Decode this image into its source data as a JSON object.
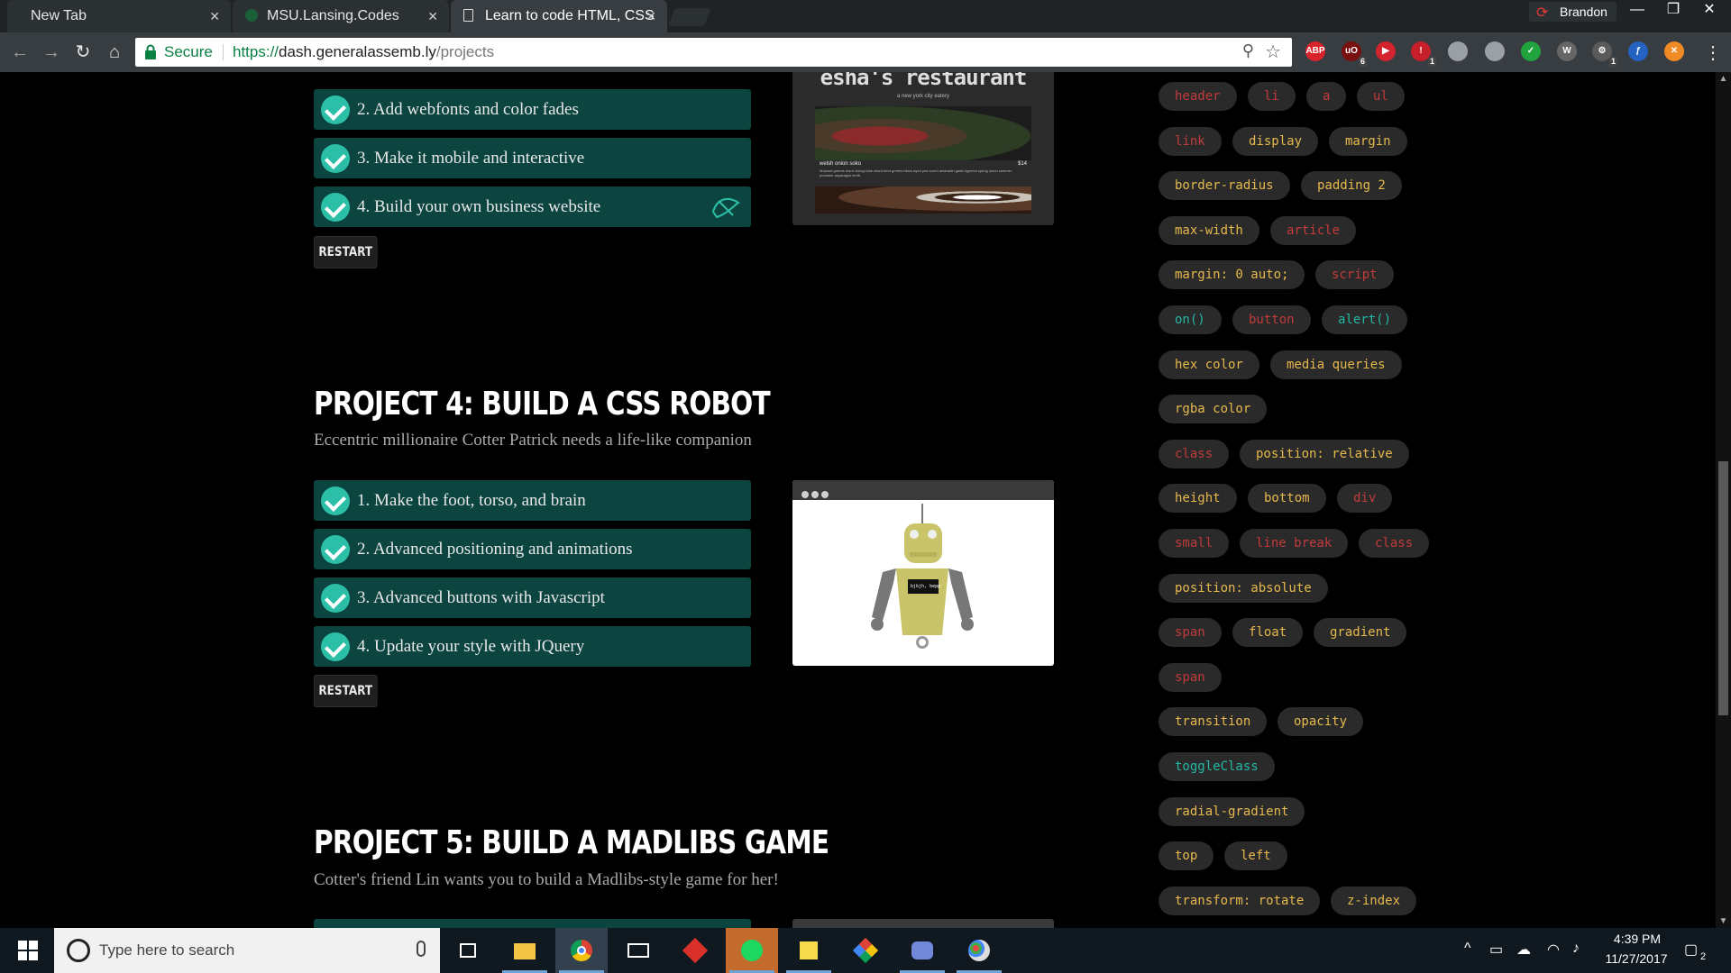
{
  "browser": {
    "tabs": [
      {
        "label": "New Tab",
        "active": false
      },
      {
        "label": "MSU.Lansing.Codes",
        "active": false
      },
      {
        "label": "Learn to code HTML, CSS",
        "active": true
      }
    ],
    "profile_name": "Brandon",
    "secure_label": "Secure",
    "url_scheme": "https://",
    "url_host": "dash.generalassemb.ly",
    "url_path": "/projects",
    "extensions": [
      {
        "name": "adblock-plus-icon",
        "text": "ABP",
        "color": "#d9232a",
        "badge": ""
      },
      {
        "name": "ublock-icon",
        "text": "uO",
        "color": "#7a0f0f",
        "badge": "6"
      },
      {
        "name": "pocket-icon",
        "text": "▶",
        "color": "#d3232f",
        "badge": ""
      },
      {
        "name": "lastpass-icon",
        "text": "!",
        "color": "#c8202b",
        "badge": "1"
      },
      {
        "name": "extension-gray-icon",
        "text": "",
        "color": "#9aa0a4",
        "badge": ""
      },
      {
        "name": "extension-gray2-icon",
        "text": "",
        "color": "#9aa0a4",
        "badge": ""
      },
      {
        "name": "grammarly-check-icon",
        "text": "✓",
        "color": "#21a33e",
        "badge": ""
      },
      {
        "name": "wikipedia-icon",
        "text": "W",
        "color": "#666",
        "badge": ""
      },
      {
        "name": "ext-red-badge-icon",
        "text": "⚙",
        "color": "#5a5a5a",
        "badge": "1"
      },
      {
        "name": "ext-blue-icon",
        "text": "ƒ",
        "color": "#2463c2",
        "badge": ""
      },
      {
        "name": "ext-orange-icon",
        "text": "✕",
        "color": "#f08a24",
        "badge": ""
      }
    ]
  },
  "project3": {
    "steps": [
      "2. Add webfonts and color fades",
      "3. Make it mobile and interactive",
      "4. Build your own business website"
    ],
    "restart_label": "RESTART",
    "thumb_title": "esha's restaurant",
    "thumb_tagline": "a new york city eatery",
    "thumb_dish": "welsh onion soko",
    "thumb_price": "$14",
    "thumb_desc": "Mustard greens leone bologi kale chard beet greens black-eyed pea sorrel amaranth garlic tigernut spring onion summer purslane asparagus lentil."
  },
  "project4": {
    "title": "PROJECT 4: BUILD A CSS ROBOT",
    "subtitle": "Eccentric millionaire Cotter Patrick needs a life-like companion",
    "steps": [
      "1. Make the foot, torso, and brain",
      "2. Advanced positioning and animations",
      "3. Advanced buttons with Javascript",
      "4. Update your style with JQuery"
    ],
    "restart_label": "RESTART",
    "robot_screen_text": "bjkjh, bepp"
  },
  "project5": {
    "title": "PROJECT 5: BUILD A MADLIBS GAME",
    "subtitle": "Cotter's friend Lin wants you to build a Madlibs-style game for her!"
  },
  "concepts": {
    "rows": [
      [
        {
          "t": "header",
          "c": "red"
        },
        {
          "t": "li",
          "c": "red"
        },
        {
          "t": "a",
          "c": "red"
        },
        {
          "t": "ul",
          "c": "red"
        }
      ],
      [
        {
          "t": "link",
          "c": "red"
        },
        {
          "t": "display",
          "c": "gold"
        },
        {
          "t": "margin",
          "c": "gold"
        }
      ],
      [
        {
          "t": "border-radius",
          "c": "gold"
        },
        {
          "t": "padding 2",
          "c": "gold"
        }
      ],
      [
        {
          "t": "max-width",
          "c": "gold"
        },
        {
          "t": "article",
          "c": "red"
        }
      ],
      [
        {
          "t": "margin: 0 auto;",
          "c": "gold"
        },
        {
          "t": "script",
          "c": "red"
        }
      ],
      [
        {
          "t": "on()",
          "c": "teal"
        },
        {
          "t": "button",
          "c": "red"
        },
        {
          "t": "alert()",
          "c": "teal"
        }
      ],
      [
        {
          "t": "hex color",
          "c": "gold"
        },
        {
          "t": "media queries",
          "c": "gold"
        }
      ],
      [
        {
          "t": "rgba color",
          "c": "gold"
        }
      ],
      [
        {
          "t": "class",
          "c": "red"
        },
        {
          "t": "position: relative",
          "c": "gold"
        }
      ],
      [
        {
          "t": "height",
          "c": "gold"
        },
        {
          "t": "bottom",
          "c": "gold"
        },
        {
          "t": "div",
          "c": "red"
        }
      ],
      [
        {
          "t": "small",
          "c": "red"
        },
        {
          "t": "line break",
          "c": "red"
        },
        {
          "t": "class",
          "c": "red"
        }
      ],
      [
        {
          "t": "position: absolute",
          "c": "gold"
        }
      ],
      [
        {
          "t": "span",
          "c": "red"
        },
        {
          "t": "float",
          "c": "gold"
        },
        {
          "t": "gradient",
          "c": "gold"
        }
      ],
      [
        {
          "t": "span",
          "c": "red"
        }
      ],
      [
        {
          "t": "transition",
          "c": "gold"
        },
        {
          "t": "opacity",
          "c": "gold"
        }
      ],
      [
        {
          "t": "toggleClass",
          "c": "teal"
        }
      ],
      [
        {
          "t": "radial-gradient",
          "c": "gold"
        }
      ],
      [
        {
          "t": "top",
          "c": "gold"
        },
        {
          "t": "left",
          "c": "gold"
        }
      ],
      [
        {
          "t": "transform: rotate",
          "c": "gold"
        },
        {
          "t": "z-index",
          "c": "gold"
        }
      ]
    ]
  },
  "taskbar": {
    "search_placeholder": "Type here to search",
    "time": "4:39 PM",
    "date": "11/27/2017",
    "notification_count": "2"
  }
}
